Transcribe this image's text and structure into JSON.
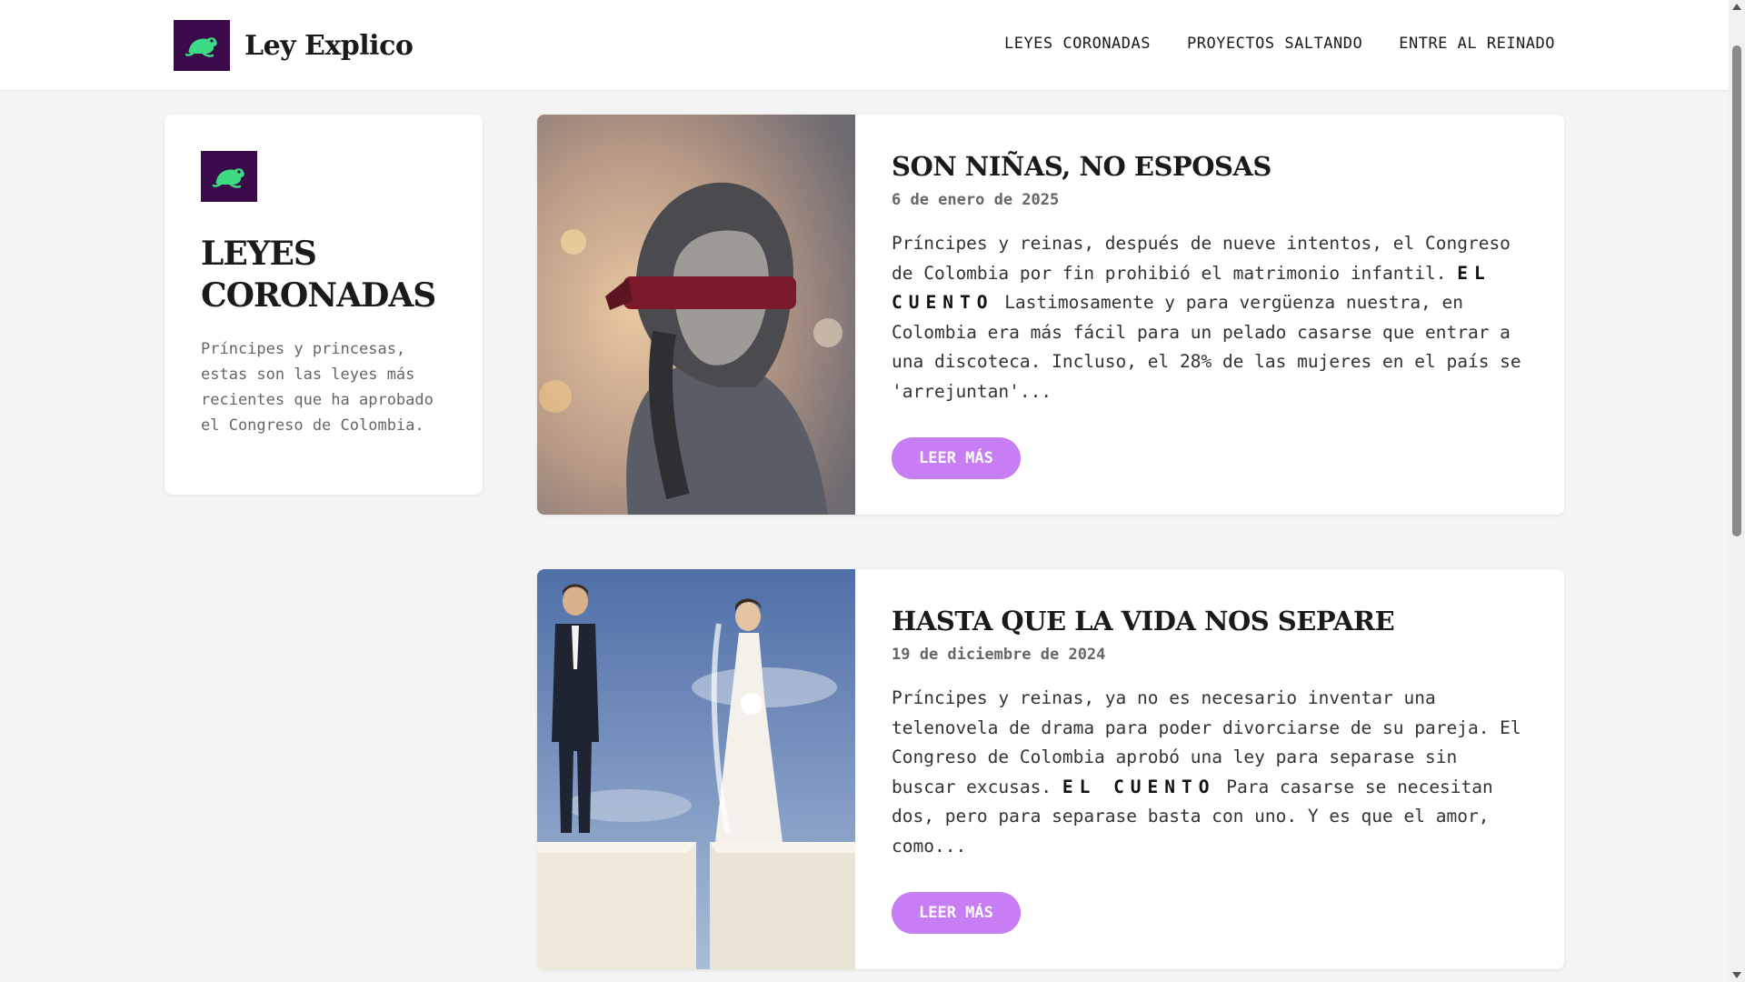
{
  "header": {
    "brand_name": "Ley Explico",
    "logo_icon": "frog-icon",
    "nav": [
      {
        "label": "LEYES CORONADAS"
      },
      {
        "label": "PROYECTOS SALTANDO"
      },
      {
        "label": "ENTRE AL REINADO"
      }
    ]
  },
  "sidebar": {
    "title": "LEYES CORONADAS",
    "description": "Príncipes y princesas, estas son las leyes más recientes que ha aprobado el Congreso de Colombia."
  },
  "posts": [
    {
      "title": "SON NIÑAS, NO ESPOSAS",
      "date": "6 de enero de 2025",
      "excerpt_before": "Príncipes y reinas, después de nueve intentos, el Congreso de Colombia por fin prohibió el matrimonio infantil. ",
      "excerpt_bold": "EL CUENTO",
      "excerpt_after": " Lastimosamente y para vergüenza nuestra, en Colombia era más fácil para un pelado casarse que entrar a una discoteca. Incluso, el 28% de las mujeres en el país se 'arrejuntan'...",
      "button": "LEER MÁS",
      "image": "blindfolded-girl-photo"
    },
    {
      "title": "HASTA QUE LA VIDA NOS SEPARE",
      "date": "19 de diciembre de 2024",
      "excerpt_before": "Príncipes y reinas, ya no es necesario inventar una telenovela de drama para poder divorciarse de su pareja. El Congreso de Colombia aprobó una ley para separase sin buscar excusas. ",
      "excerpt_bold": "EL CUENTO",
      "excerpt_after": " Para casarse se necesitan dos, pero para separase basta con uno. Y es que el amor, como...",
      "button": "LEER MÁS",
      "image": "split-wedding-cake-photo"
    }
  ],
  "colors": {
    "brand_purple": "#3a0a4a",
    "frog_green": "#3ddc84",
    "button": "#c77df3",
    "background": "#f4f4f4"
  }
}
